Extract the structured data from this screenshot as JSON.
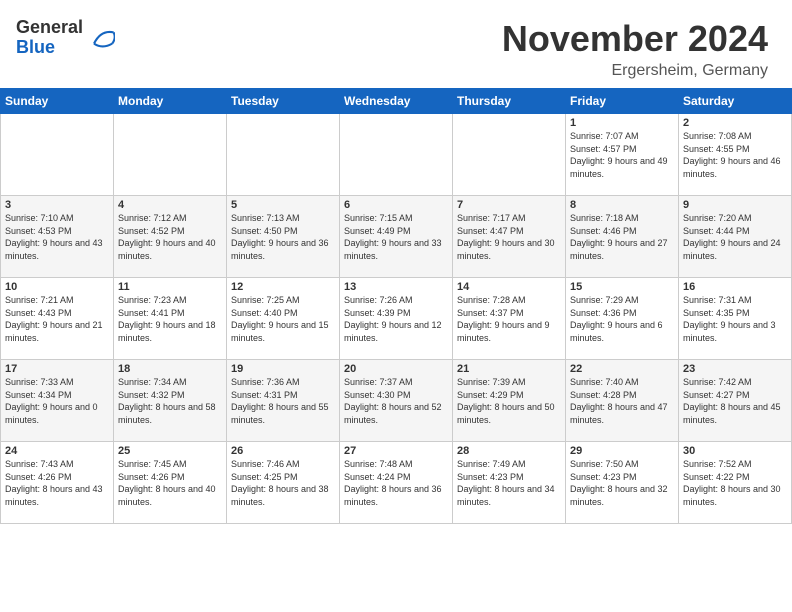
{
  "logo": {
    "general": "General",
    "blue": "Blue"
  },
  "title": "November 2024",
  "location": "Ergersheim, Germany",
  "weekdays": [
    "Sunday",
    "Monday",
    "Tuesday",
    "Wednesday",
    "Thursday",
    "Friday",
    "Saturday"
  ],
  "days": [
    {
      "date": 1,
      "col": 5,
      "sunrise": "7:07 AM",
      "sunset": "4:57 PM",
      "daylight": "9 hours and 49 minutes."
    },
    {
      "date": 2,
      "col": 6,
      "sunrise": "7:08 AM",
      "sunset": "4:55 PM",
      "daylight": "9 hours and 46 minutes."
    },
    {
      "date": 3,
      "col": 0,
      "sunrise": "7:10 AM",
      "sunset": "4:53 PM",
      "daylight": "9 hours and 43 minutes."
    },
    {
      "date": 4,
      "col": 1,
      "sunrise": "7:12 AM",
      "sunset": "4:52 PM",
      "daylight": "9 hours and 40 minutes."
    },
    {
      "date": 5,
      "col": 2,
      "sunrise": "7:13 AM",
      "sunset": "4:50 PM",
      "daylight": "9 hours and 36 minutes."
    },
    {
      "date": 6,
      "col": 3,
      "sunrise": "7:15 AM",
      "sunset": "4:49 PM",
      "daylight": "9 hours and 33 minutes."
    },
    {
      "date": 7,
      "col": 4,
      "sunrise": "7:17 AM",
      "sunset": "4:47 PM",
      "daylight": "9 hours and 30 minutes."
    },
    {
      "date": 8,
      "col": 5,
      "sunrise": "7:18 AM",
      "sunset": "4:46 PM",
      "daylight": "9 hours and 27 minutes."
    },
    {
      "date": 9,
      "col": 6,
      "sunrise": "7:20 AM",
      "sunset": "4:44 PM",
      "daylight": "9 hours and 24 minutes."
    },
    {
      "date": 10,
      "col": 0,
      "sunrise": "7:21 AM",
      "sunset": "4:43 PM",
      "daylight": "9 hours and 21 minutes."
    },
    {
      "date": 11,
      "col": 1,
      "sunrise": "7:23 AM",
      "sunset": "4:41 PM",
      "daylight": "9 hours and 18 minutes."
    },
    {
      "date": 12,
      "col": 2,
      "sunrise": "7:25 AM",
      "sunset": "4:40 PM",
      "daylight": "9 hours and 15 minutes."
    },
    {
      "date": 13,
      "col": 3,
      "sunrise": "7:26 AM",
      "sunset": "4:39 PM",
      "daylight": "9 hours and 12 minutes."
    },
    {
      "date": 14,
      "col": 4,
      "sunrise": "7:28 AM",
      "sunset": "4:37 PM",
      "daylight": "9 hours and 9 minutes."
    },
    {
      "date": 15,
      "col": 5,
      "sunrise": "7:29 AM",
      "sunset": "4:36 PM",
      "daylight": "9 hours and 6 minutes."
    },
    {
      "date": 16,
      "col": 6,
      "sunrise": "7:31 AM",
      "sunset": "4:35 PM",
      "daylight": "9 hours and 3 minutes."
    },
    {
      "date": 17,
      "col": 0,
      "sunrise": "7:33 AM",
      "sunset": "4:34 PM",
      "daylight": "9 hours and 0 minutes."
    },
    {
      "date": 18,
      "col": 1,
      "sunrise": "7:34 AM",
      "sunset": "4:32 PM",
      "daylight": "8 hours and 58 minutes."
    },
    {
      "date": 19,
      "col": 2,
      "sunrise": "7:36 AM",
      "sunset": "4:31 PM",
      "daylight": "8 hours and 55 minutes."
    },
    {
      "date": 20,
      "col": 3,
      "sunrise": "7:37 AM",
      "sunset": "4:30 PM",
      "daylight": "8 hours and 52 minutes."
    },
    {
      "date": 21,
      "col": 4,
      "sunrise": "7:39 AM",
      "sunset": "4:29 PM",
      "daylight": "8 hours and 50 minutes."
    },
    {
      "date": 22,
      "col": 5,
      "sunrise": "7:40 AM",
      "sunset": "4:28 PM",
      "daylight": "8 hours and 47 minutes."
    },
    {
      "date": 23,
      "col": 6,
      "sunrise": "7:42 AM",
      "sunset": "4:27 PM",
      "daylight": "8 hours and 45 minutes."
    },
    {
      "date": 24,
      "col": 0,
      "sunrise": "7:43 AM",
      "sunset": "4:26 PM",
      "daylight": "8 hours and 43 minutes."
    },
    {
      "date": 25,
      "col": 1,
      "sunrise": "7:45 AM",
      "sunset": "4:26 PM",
      "daylight": "8 hours and 40 minutes."
    },
    {
      "date": 26,
      "col": 2,
      "sunrise": "7:46 AM",
      "sunset": "4:25 PM",
      "daylight": "8 hours and 38 minutes."
    },
    {
      "date": 27,
      "col": 3,
      "sunrise": "7:48 AM",
      "sunset": "4:24 PM",
      "daylight": "8 hours and 36 minutes."
    },
    {
      "date": 28,
      "col": 4,
      "sunrise": "7:49 AM",
      "sunset": "4:23 PM",
      "daylight": "8 hours and 34 minutes."
    },
    {
      "date": 29,
      "col": 5,
      "sunrise": "7:50 AM",
      "sunset": "4:23 PM",
      "daylight": "8 hours and 32 minutes."
    },
    {
      "date": 30,
      "col": 6,
      "sunrise": "7:52 AM",
      "sunset": "4:22 PM",
      "daylight": "8 hours and 30 minutes."
    }
  ],
  "labels": {
    "sunrise": "Sunrise:",
    "sunset": "Sunset:",
    "daylight": "Daylight:"
  }
}
